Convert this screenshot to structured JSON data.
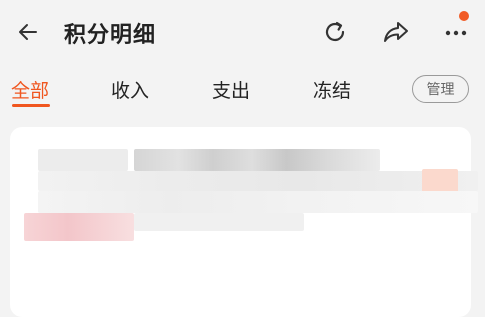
{
  "header": {
    "title": "积分明细",
    "back_icon": "back-arrow-icon",
    "refresh_icon": "refresh-icon",
    "share_icon": "share-icon",
    "more_icon": "more-icon",
    "notification_color": "#f15a24"
  },
  "tabs": [
    {
      "label": "全部",
      "active": true
    },
    {
      "label": "收入",
      "active": false
    },
    {
      "label": "支出",
      "active": false
    },
    {
      "label": "冻结",
      "active": false
    }
  ],
  "manage_label": "管理",
  "colors": {
    "accent": "#f0561f",
    "background": "#f3f3f3",
    "card": "#ffffff"
  }
}
